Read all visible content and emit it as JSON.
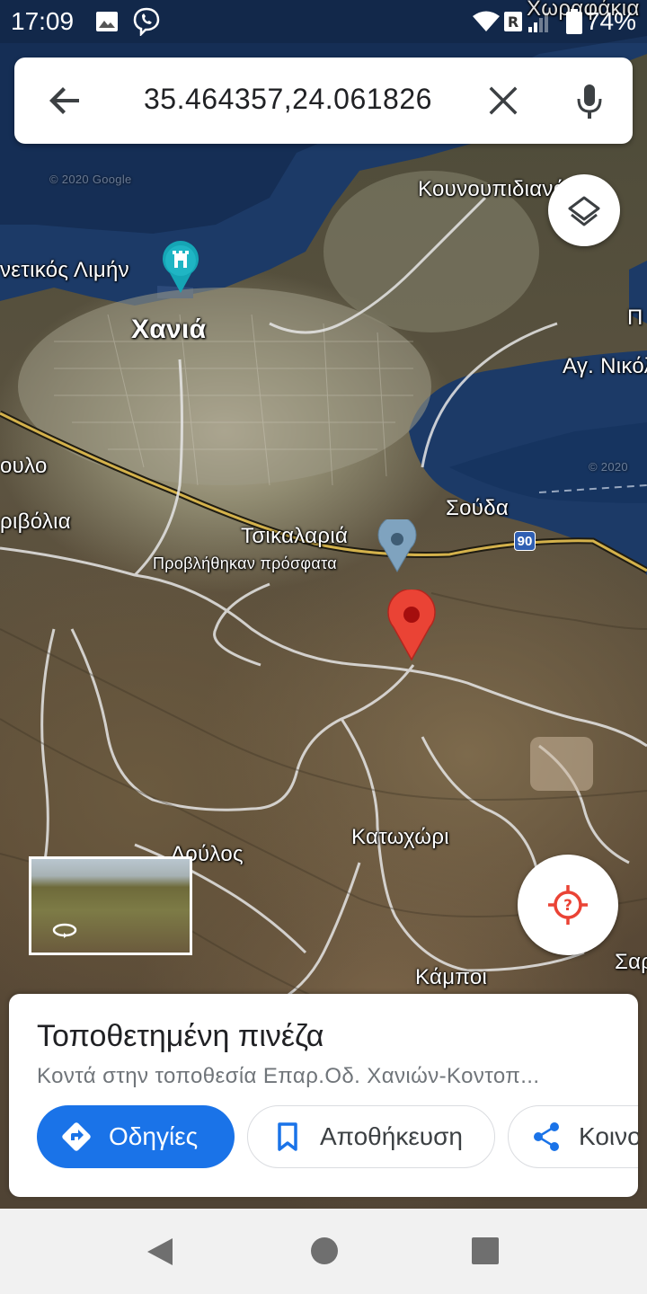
{
  "status_bar": {
    "time": "17:09",
    "battery": "74%",
    "icons": [
      "image-icon",
      "viber-icon",
      "wifi-icon",
      "roaming-icon",
      "signal-icon",
      "battery-icon"
    ]
  },
  "search": {
    "query": "35.464357,24.061826",
    "back_icon": "arrow-back-icon",
    "clear_icon": "close-icon",
    "mic_icon": "mic-icon"
  },
  "map": {
    "labels": {
      "chorafakia": "Χωραφάκια",
      "kounoupidiana": "Κουνουπιδιανά",
      "enetikos_limin": "νετικός Λιμήν",
      "chania": "Χανιά",
      "p_cut": "Π",
      "ag_nikolaos": "Αγ. Νικόλ",
      "roulo": "ουλο",
      "perivolia": "ριβόλια",
      "souda": "Σούδα",
      "tsikalaria": "Τσικαλαριά",
      "recently_viewed": "Προβλήθηκαν πρόσφατα",
      "route_90": "90",
      "katochori": "Κατωχώρι",
      "doulos": "Δούλος",
      "kampoi": "Κάμποι",
      "sar": "Σαρ",
      "copyright_1": "© 2020 Google",
      "copyright_2": "© 2020"
    },
    "colors": {
      "sea": "#1c3a67",
      "dropped_pin": "#ea4335",
      "recent_pin": "#7fa3bf",
      "roads": "#e6e6e6",
      "highway": "#d4b24c"
    }
  },
  "place": {
    "title": "Τοποθετημένη πινέζα",
    "subtitle": "Κοντά στην τοποθεσία Επαρ.Οδ. Χανιών-Κοντοπ...",
    "buttons": {
      "directions": "Οδηγίες",
      "save": "Αποθήκευση",
      "share": "Κοινοποίηση"
    },
    "accent_color": "#1a73e8"
  }
}
